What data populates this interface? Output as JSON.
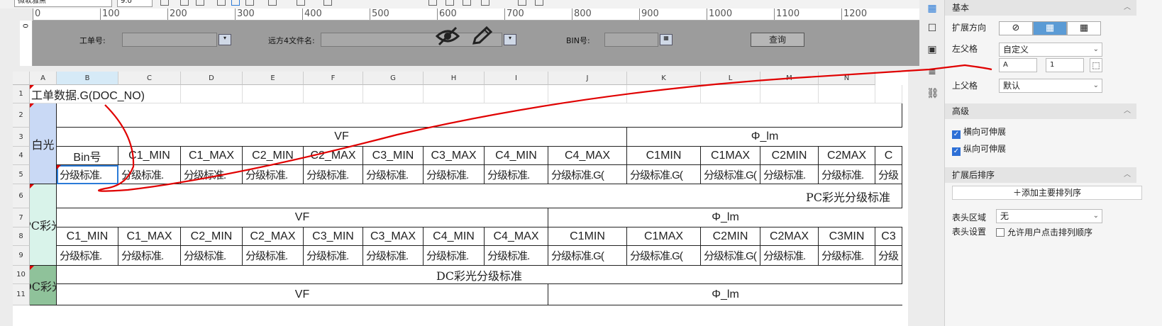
{
  "toolbar": {
    "font_name": "微软雅黑",
    "font_size": "9.0"
  },
  "ruler": {
    "ticks": [
      "0",
      "100",
      "200",
      "300",
      "400",
      "500",
      "600",
      "700",
      "800",
      "900",
      "1000",
      "1100",
      "1200"
    ],
    "vtick": "0"
  },
  "params": {
    "order_label": "工单号:",
    "file_label": "远方4文件名:",
    "bin_label": "BIN号:",
    "query_button": "查询",
    "eye_icon": "hidden-eye-icon",
    "pen_icon": "pen-icon"
  },
  "sheet": {
    "columns": [
      "A",
      "B",
      "C",
      "D",
      "E",
      "F",
      "G",
      "H",
      "I",
      "J",
      "K",
      "L",
      "M",
      "N"
    ],
    "rows": [
      "1",
      "2",
      "3",
      "4",
      "5",
      "6",
      "7",
      "8",
      "9",
      "10",
      "11"
    ],
    "r1": "工单数据.G(DOC_NO)",
    "white_label": "白光",
    "pc_label": "PC彩光",
    "dc_label": "DC彩光",
    "vf": "VF",
    "phi": "Φ_lm",
    "pc_title": "PC彩光分级标准",
    "dc_title": "DC彩光分级标准",
    "r4": [
      "Bin号",
      "C1_MIN",
      "C1_MAX",
      "C2_MIN",
      "C2_MAX",
      "C3_MIN",
      "C3_MAX",
      "C4_MIN",
      "C4_MAX",
      "C1MIN",
      "C1MAX",
      "C2MIN",
      "C2MAX",
      "C"
    ],
    "r5": [
      "分级标准.",
      "分级标准.",
      "分级标准.",
      "分级标准.",
      "分级标准.",
      "分级标准.",
      "分级标准.",
      "分级标准.",
      "分级标准.G(",
      "分级标准.G(",
      "分级标准.G(",
      "分级标准.",
      "分级标准.",
      "分级"
    ],
    "r8": [
      "C1_MIN",
      "C1_MAX",
      "C2_MIN",
      "C2_MAX",
      "C3_MIN",
      "C3_MAX",
      "C4_MIN",
      "C4_MAX",
      "C1MIN",
      "C1MAX",
      "C2MIN",
      "C2MAX",
      "C3MIN",
      "C3"
    ],
    "r9": [
      "分级标准.",
      "分级标准.",
      "分级标准.",
      "分级标准.",
      "分级标准.",
      "分级标准.",
      "分级标准.",
      "分级标准.",
      "分级标准.G(",
      "分级标准.G(",
      "分级标准.G(",
      "分级标准.",
      "分级标准.",
      "分级"
    ]
  },
  "panel": {
    "basic": "基本",
    "expand_dir": "扩展方向",
    "left_parent": "左父格",
    "left_parent_value": "自定义",
    "cell_ref_a": "A",
    "cell_ref_1": "1",
    "top_parent": "上父格",
    "top_parent_value": "默认",
    "advanced": "高级",
    "h_stretch": "横向可伸展",
    "v_stretch": "纵向可伸展",
    "sort_after": "扩展后排序",
    "add_sort": "添加主要排列序",
    "header_area": "表头区域",
    "header_area_value": "无",
    "header_settings": "表头设置",
    "allow_sort": "允许用户点击排列顺序"
  },
  "colors": {
    "accent": "#2b7bd8",
    "white_band": "#c9d9f5",
    "pc_band": "#d9f3ea",
    "dc_band": "#8fc29a",
    "annotation": "#e00000"
  }
}
